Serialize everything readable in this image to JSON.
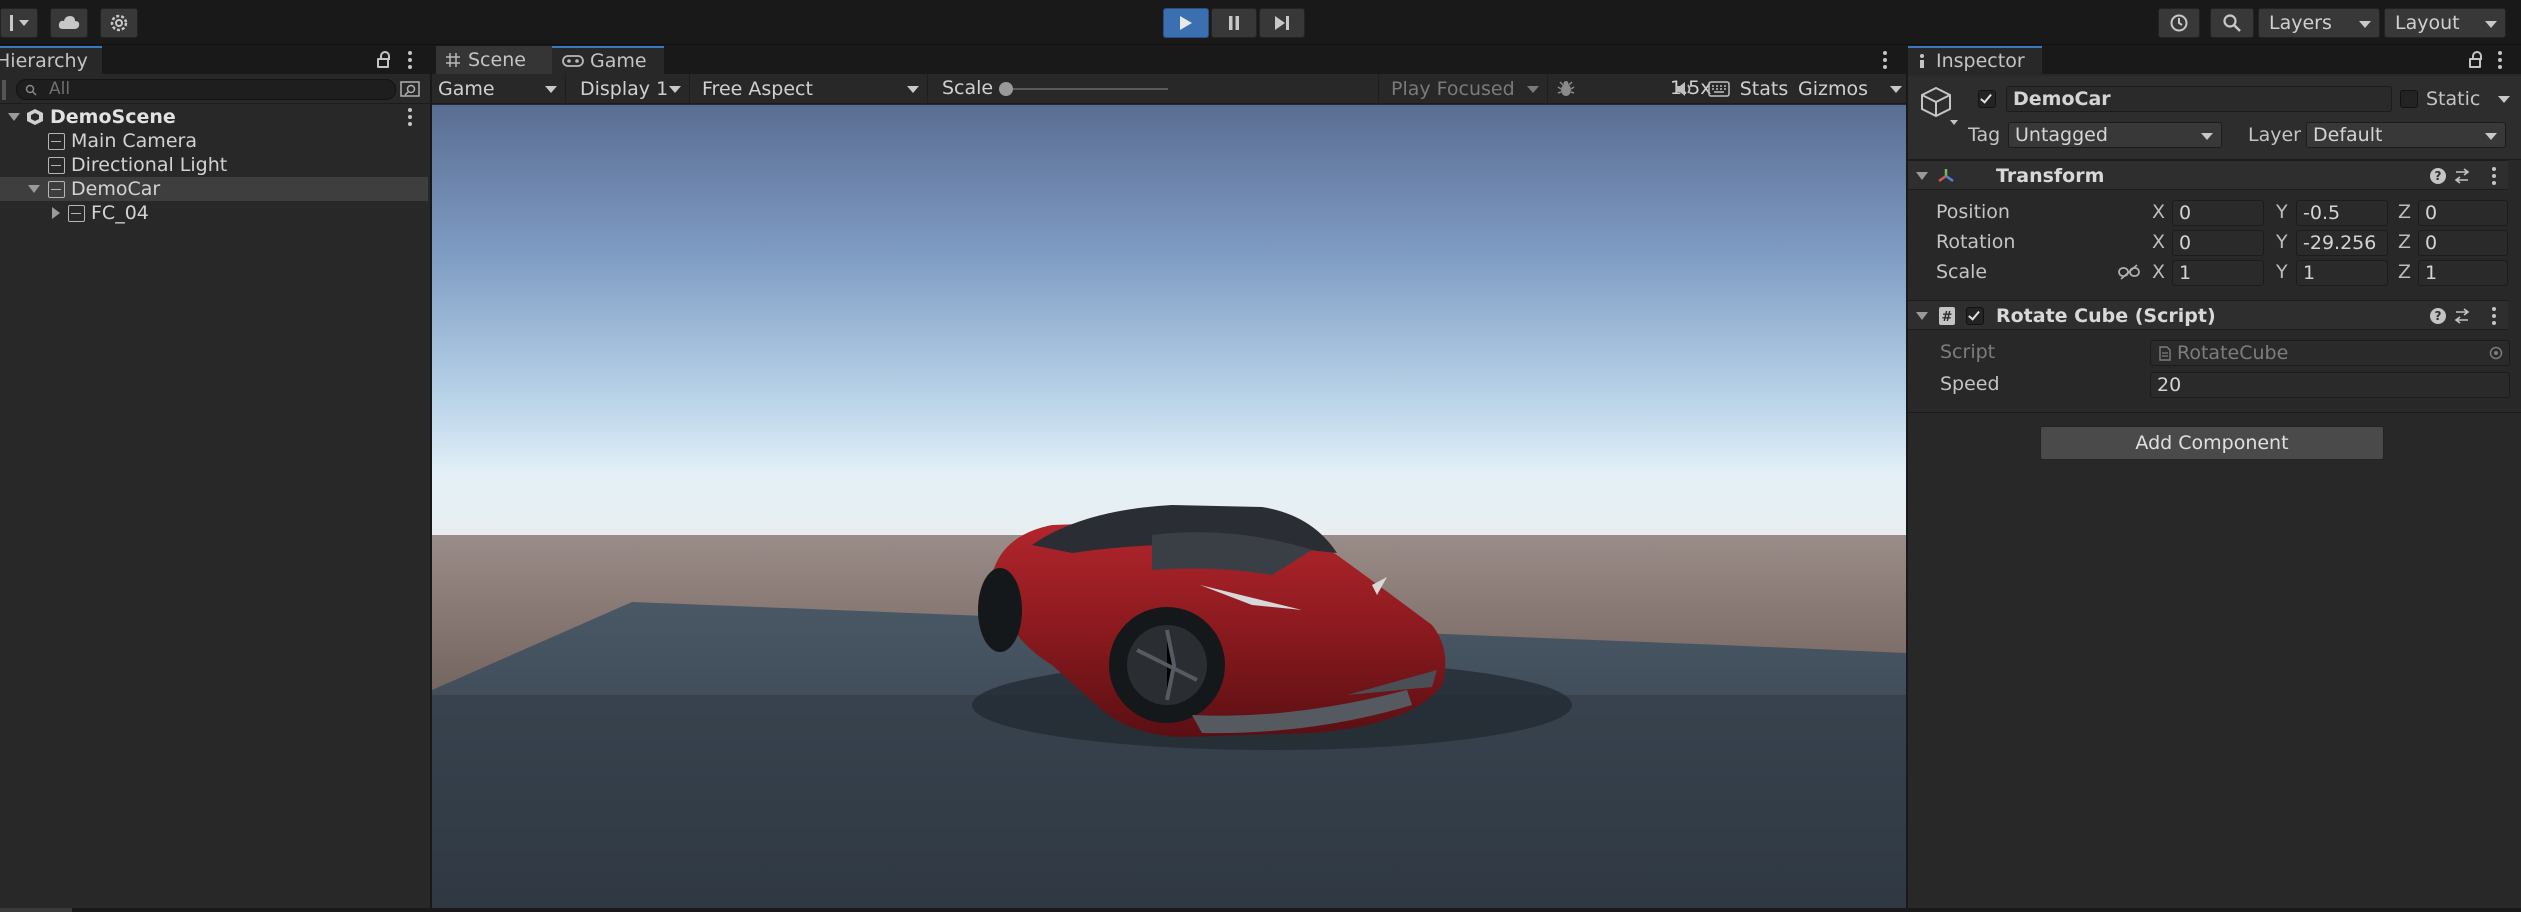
{
  "toolbar": {
    "account_label": "",
    "layers_label": "Layers",
    "layout_label": "Layout"
  },
  "hierarchy": {
    "tab_label": "Hierarchy",
    "search_placeholder": "All",
    "scene_name": "DemoScene",
    "items": [
      {
        "label": "Main Camera"
      },
      {
        "label": "Directional Light"
      },
      {
        "label": "DemoCar"
      },
      {
        "label": "FC_04"
      }
    ]
  },
  "center": {
    "tabs": [
      {
        "label": "Scene"
      },
      {
        "label": "Game"
      }
    ],
    "game_toolbar": {
      "view_mode": "Game",
      "display": "Display 1",
      "aspect": "Free Aspect",
      "scale_label": "Scale",
      "scale_value": "1.5x",
      "play_mode": "Play Focused",
      "stats_label": "Stats",
      "gizmos_label": "Gizmos"
    }
  },
  "inspector": {
    "tab_label": "Inspector",
    "object_name": "DemoCar",
    "static_label": "Static",
    "tag_label": "Tag",
    "tag_value": "Untagged",
    "layer_label": "Layer",
    "layer_value": "Default",
    "transform": {
      "title": "Transform",
      "position_label": "Position",
      "rotation_label": "Rotation",
      "scale_label": "Scale",
      "axis_x": "X",
      "axis_y": "Y",
      "axis_z": "Z",
      "position": {
        "x": "0",
        "y": "-0.5",
        "z": "0"
      },
      "rotation": {
        "x": "0",
        "y": "-29.256",
        "z": "0"
      },
      "scale": {
        "x": "1",
        "y": "1",
        "z": "1"
      }
    },
    "script_component": {
      "title": "Rotate Cube (Script)",
      "script_label": "Script",
      "script_value": "RotateCube",
      "speed_label": "Speed",
      "speed_value": "20"
    },
    "add_component_label": "Add Component"
  },
  "colors": {
    "accent": "#3a79bb",
    "play_button": "#3a6fb0",
    "panel_bg": "#282828",
    "car_body": "#8b1a1f"
  }
}
